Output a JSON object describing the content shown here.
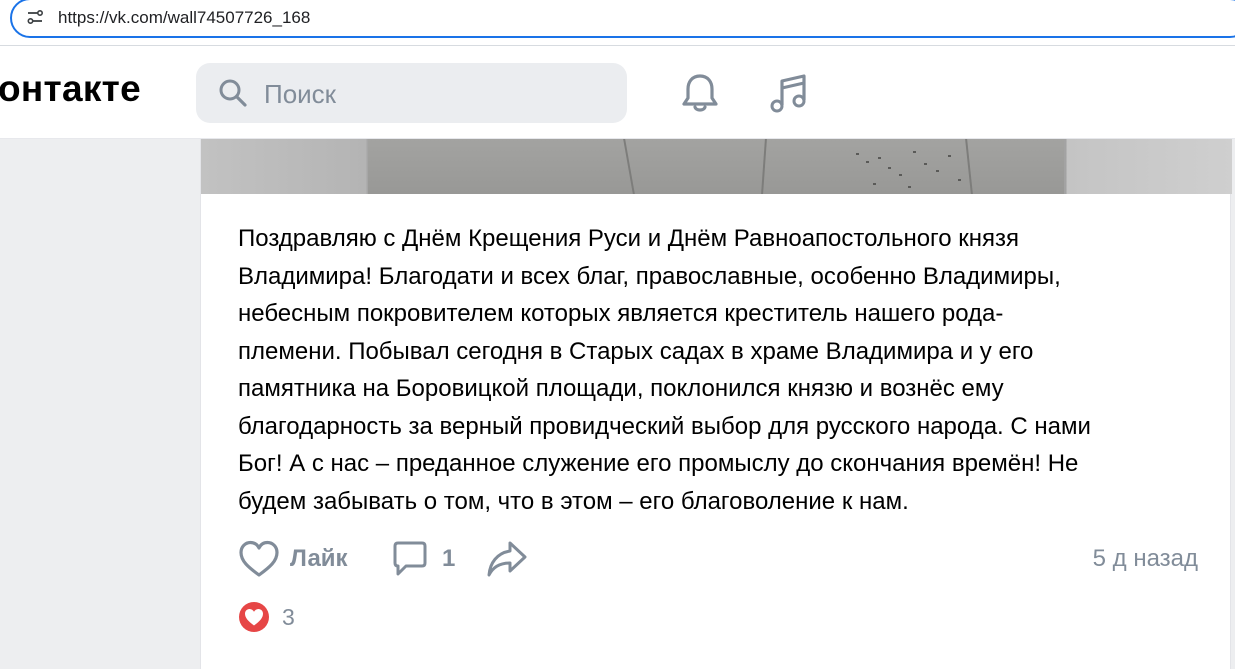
{
  "browser": {
    "url": "https://vk.com/wall74507726_168"
  },
  "header": {
    "logo_text": "онтакте",
    "search_placeholder": "Поиск"
  },
  "post": {
    "text": "Поздравляю с Днём Крещения Руси и Днём Равноапостольного князя Владимира! Благодати и всех благ, православные, особенно Владимиры, небесным покровителем которых является креститель нашего рода-племени. Побывал сегодня в Старых садах в храме Владимира и у его памятника на Боровицкой площади, поклонился князю и вознёс ему благодарность за верный провидческий выбор для русского народа. С нами Бог! А с нас – преданное служение его промыслу до скончания времён! Не будем забывать о том, что в этом – его благоволение к нам.",
    "lines": [
      "Поздравляю с Днём Крещения Руси и Днём Равноапостольного князя",
      "Владимира! Благодати и всех благ, православные, особенно Владимиры,",
      "небесным покровителем которых является креститель нашего рода-",
      "племени. Побывал сегодня в Старых садах в храме Владимира и у его",
      "памятника на Боровицкой площади, поклонился князю и вознёс ему",
      "благодарность за верный провидческий выбор для русского народа. С нами",
      "Бог! А с нас – преданное служение его промыслу до скончания времён! Не",
      "будем забывать о том, что в этом – его благоволение к нам."
    ],
    "like_label": "Лайк",
    "comment_count": "1",
    "time": "5 д назад",
    "reaction_count": "3"
  },
  "colors": {
    "accent": "#1a73e8",
    "muted": "#818c99",
    "reaction_red": "#e64646"
  },
  "icons": {
    "url": "site-settings-icon",
    "search": "search-icon",
    "bell": "bell-icon",
    "music": "music-icon",
    "like": "heart-outline-icon",
    "comment": "comment-icon",
    "share": "share-icon",
    "reaction": "heart-filled-icon"
  }
}
